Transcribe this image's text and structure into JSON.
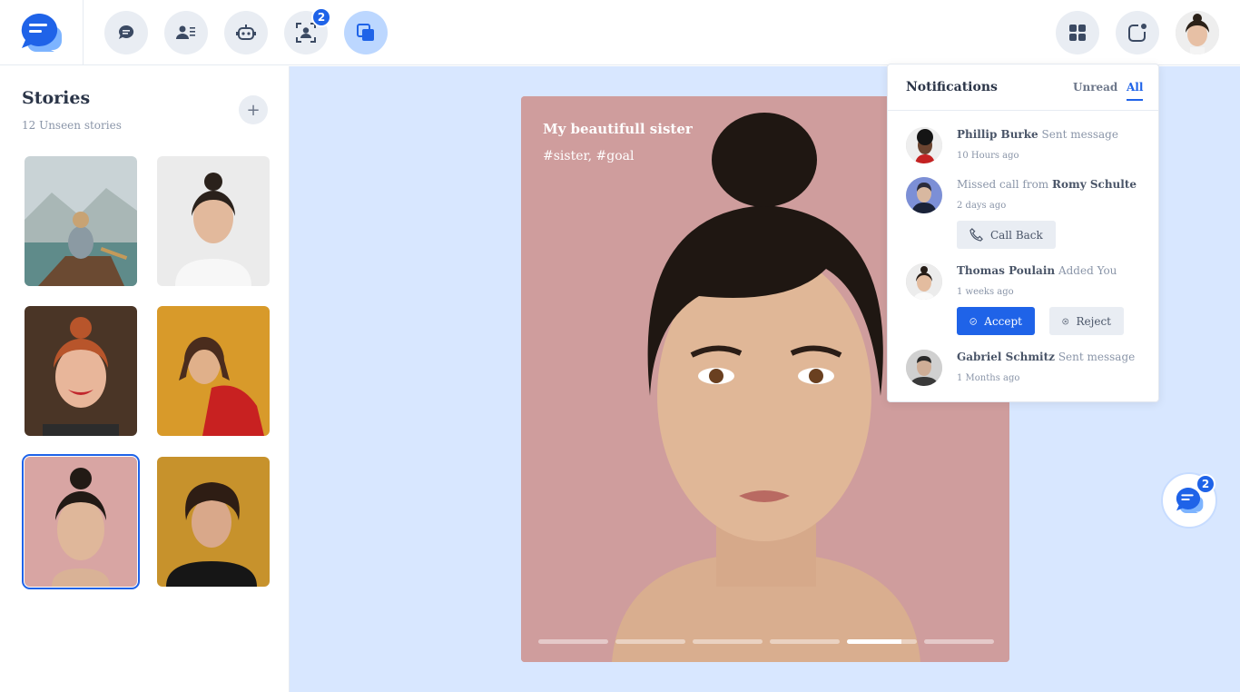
{
  "header": {
    "nav_badges": {
      "contacts": "2"
    }
  },
  "sidebar": {
    "title": "Stories",
    "subtitle": "12 Unseen stories"
  },
  "story": {
    "title": "My beautifull sister",
    "tags": "#sister, #goal",
    "segments": 6,
    "active_segment": 5,
    "active_progress": 0.78
  },
  "notifications": {
    "title": "Notifications",
    "tabs": {
      "unread": "Unread",
      "all": "All"
    },
    "items": [
      {
        "name": "Phillip Burke",
        "action": "Sent message",
        "time": "10 Hours ago"
      },
      {
        "prefix": "Missed call from",
        "name": "Romy Schulte",
        "time": "2 days ago",
        "button": "Call Back"
      },
      {
        "name": "Thomas Poulain",
        "action": "Added You",
        "time": "1 weeks ago",
        "accept": "Accept",
        "reject": "Reject"
      },
      {
        "name": "Gabriel Schmitz",
        "action": "Sent message",
        "time": "1 Months ago"
      }
    ]
  },
  "chat_fab": {
    "badge": "2"
  },
  "colors": {
    "accent": "#1f63e8",
    "main_bg": "#d8e7ff",
    "button_grey": "#e9edf3"
  }
}
